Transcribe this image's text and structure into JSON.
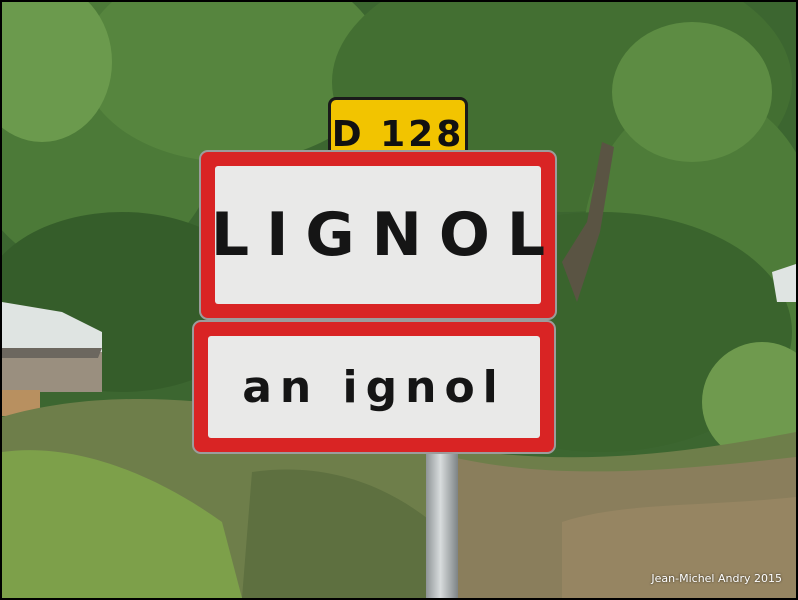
{
  "road_plate": {
    "text": "D 128"
  },
  "sign_top": {
    "text": "LIGNOL"
  },
  "sign_bottom": {
    "text": "an ignol"
  },
  "credit": {
    "text": "Jean-Michel Andry 2015"
  },
  "colors": {
    "plate_yellow": "#f2c400",
    "sign_red": "#d92424",
    "sign_white": "#e9e9e8",
    "foliage": "#3f6a30"
  }
}
